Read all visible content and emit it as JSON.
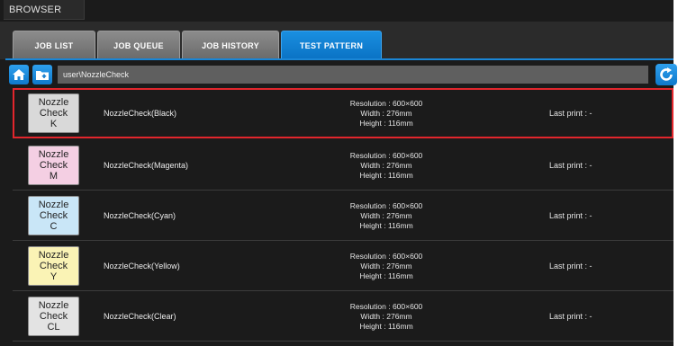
{
  "window": {
    "title": "BROWSER"
  },
  "tabs": [
    {
      "label": "JOB LIST",
      "active": false
    },
    {
      "label": "JOB QUEUE",
      "active": false
    },
    {
      "label": "JOB HISTORY",
      "active": false
    },
    {
      "label": "TEST PATTERN",
      "active": true
    }
  ],
  "pathbar": {
    "home_icon": "home-icon",
    "folder_icon": "folder-icon",
    "path": "user\\NozzleCheck",
    "refresh_icon": "refresh-icon"
  },
  "patterns": [
    {
      "thumb_lines": [
        "Nozzle",
        "Check",
        "K"
      ],
      "thumb_color": "#d9d9d9",
      "name": "NozzleCheck(Black)",
      "resolution": "Resolution : 600×600",
      "width": "Width : 276mm",
      "height": "Height : 116mm",
      "last_print": "Last print : -",
      "selected": true
    },
    {
      "thumb_lines": [
        "Nozzle",
        "Check",
        "M"
      ],
      "thumb_color": "#f4cfe3",
      "name": "NozzleCheck(Magenta)",
      "resolution": "Resolution : 600×600",
      "width": "Width : 276mm",
      "height": "Height : 116mm",
      "last_print": "Last print : -",
      "selected": false
    },
    {
      "thumb_lines": [
        "Nozzle",
        "Check",
        "C"
      ],
      "thumb_color": "#c9e6f7",
      "name": "NozzleCheck(Cyan)",
      "resolution": "Resolution : 600×600",
      "width": "Width : 276mm",
      "height": "Height : 116mm",
      "last_print": "Last print : -",
      "selected": false
    },
    {
      "thumb_lines": [
        "Nozzle",
        "Check",
        "Y"
      ],
      "thumb_color": "#faf3b5",
      "name": "NozzleCheck(Yellow)",
      "resolution": "Resolution : 600×600",
      "width": "Width : 276mm",
      "height": "Height : 116mm",
      "last_print": "Last print : -",
      "selected": false
    },
    {
      "thumb_lines": [
        "Nozzle",
        "Check",
        "CL"
      ],
      "thumb_color": "#e3e3e3",
      "name": "NozzleCheck(Clear)",
      "resolution": "Resolution : 600×600",
      "width": "Width : 276mm",
      "height": "Height : 116mm",
      "last_print": "Last print : -",
      "selected": false
    }
  ],
  "colors": {
    "accent": "#0a84d6",
    "selection": "#e2262c",
    "background": "#1b1b1b"
  }
}
